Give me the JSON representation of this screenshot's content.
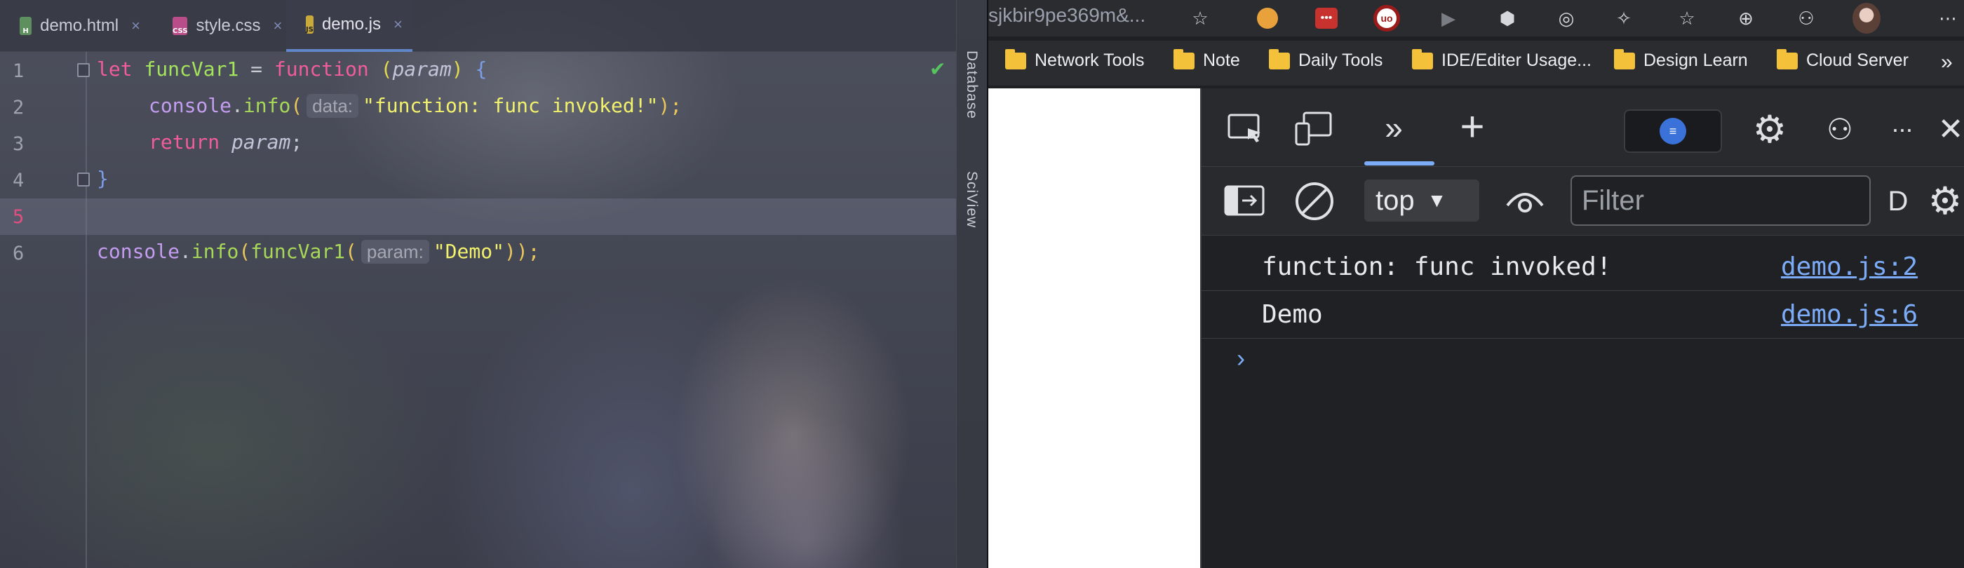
{
  "ide": {
    "tabs": [
      {
        "icon": "html-file-icon",
        "label": "demo.html",
        "badge": "H"
      },
      {
        "icon": "css-file-icon",
        "label": "style.css",
        "badge": "CSS"
      },
      {
        "icon": "js-file-icon",
        "label": "demo.js",
        "badge": "JS",
        "active": true
      }
    ],
    "tab_close_glyph": "×",
    "line_numbers": [
      "1",
      "2",
      "3",
      "4",
      "5",
      "6"
    ],
    "code": {
      "l1": {
        "kw_let": "let",
        "name": "funcVar1",
        "eq": " = ",
        "kw_function": "function",
        "open": " (",
        "param": "param",
        "close": ") ",
        "brace": "{"
      },
      "l2": {
        "obj": "console",
        "dot": ".",
        "method": "info",
        "open": "(",
        "hint": "data:",
        "str": "\"function: func invoked!\"",
        "end": ");"
      },
      "l3": {
        "kw_return": "return",
        "param": "param",
        "end": ";"
      },
      "l4": {
        "brace": "}"
      },
      "l6": {
        "obj": "console",
        "dot": ".",
        "method": "info",
        "open": "(",
        "fn": "funcVar1",
        "open2": "(",
        "hint": "param:",
        "str": "\"Demo\"",
        "end": "));"
      }
    },
    "inspection_icon": "check-icon",
    "side_panels": [
      "Database",
      "SciView"
    ]
  },
  "browser": {
    "url_fragment": "sjkbir9pe369m&...",
    "toolbar_icons": [
      "star-add-icon",
      "extension-bird-icon",
      "extension-dots-icon",
      "ublock-icon",
      "play-icon",
      "cube-icon",
      "glasses-icon",
      "puzzle-icon",
      "favorites-icon",
      "collections-icon",
      "profile-sync-icon",
      "avatar"
    ],
    "bookmarks": [
      "Network Tools",
      "Note",
      "Daily Tools",
      "IDE/Editer Usage...",
      "Design Learn",
      "Cloud Server"
    ],
    "bookmark_overflow": "»",
    "devtools": {
      "tabs_icons": [
        "inspect-icon",
        "device-toolbar-icon",
        "more-tabs-icon",
        "add-tab-icon",
        "feedback-icon",
        "settings-icon",
        "customize-icon",
        "more-options-icon",
        "close-icon"
      ],
      "more_tabs_glyph": "»",
      "add_glyph": "+",
      "more_glyph": "···",
      "close_glyph": "✕",
      "context": "top",
      "context_caret": "▼",
      "filter_placeholder": "Filter",
      "default_levels_cut": "D",
      "logs": [
        {
          "message": "function: func invoked!",
          "source": "demo.js:2"
        },
        {
          "message": "Demo",
          "source": "demo.js:6"
        }
      ],
      "prompt_glyph": "›"
    }
  },
  "colors": {
    "keyword": "#f05d9a",
    "function_name": "#a4e35c",
    "string": "#f2f16c",
    "link": "#7cacf8",
    "active_line_number": "#e04f7f"
  }
}
